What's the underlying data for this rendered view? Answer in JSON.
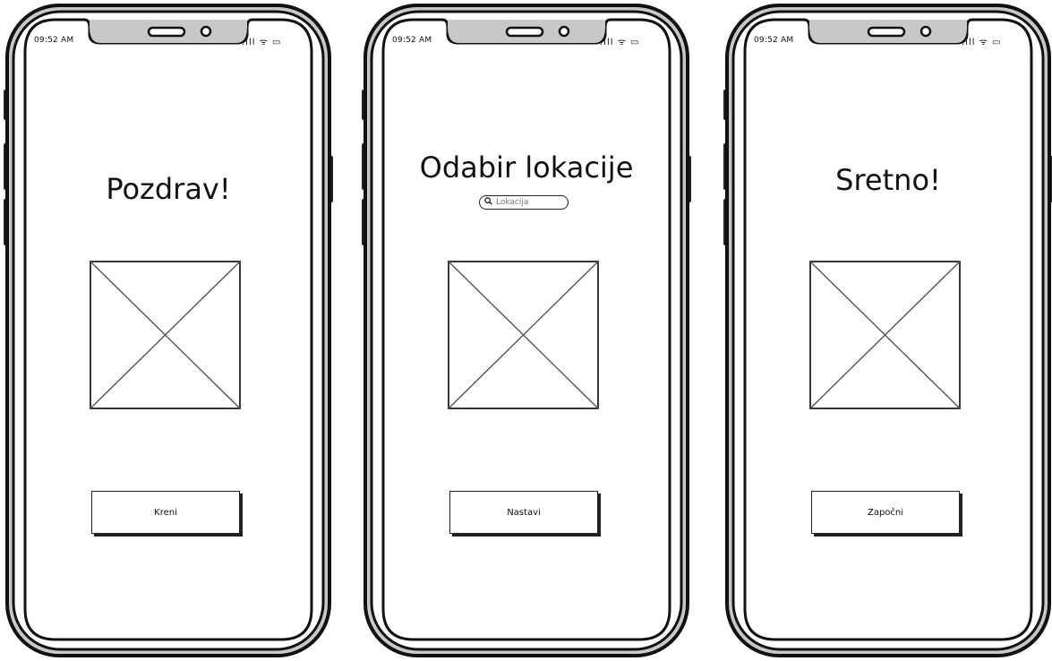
{
  "screens": [
    {
      "status_time": "09:52 AM",
      "status_icons": ".ıll ᯤ ▭",
      "title": "Pozdrav!",
      "button_label": "Kreni"
    },
    {
      "status_time": "09:52 AM",
      "status_icons": ".ıll ᯤ ▭",
      "title": "Odabir lokacije",
      "search_placeholder": "Lokacija",
      "button_label": "Nastavi"
    },
    {
      "status_time": "09:52 AM",
      "status_icons": ".ıll ᯤ ▭",
      "title": "Sretno!",
      "button_label": "Započni"
    }
  ],
  "icons": {
    "search": "search-icon",
    "image_placeholder": "image-placeholder-icon",
    "signal": "signal-icon",
    "wifi": "wifi-icon",
    "battery": "battery-icon"
  }
}
